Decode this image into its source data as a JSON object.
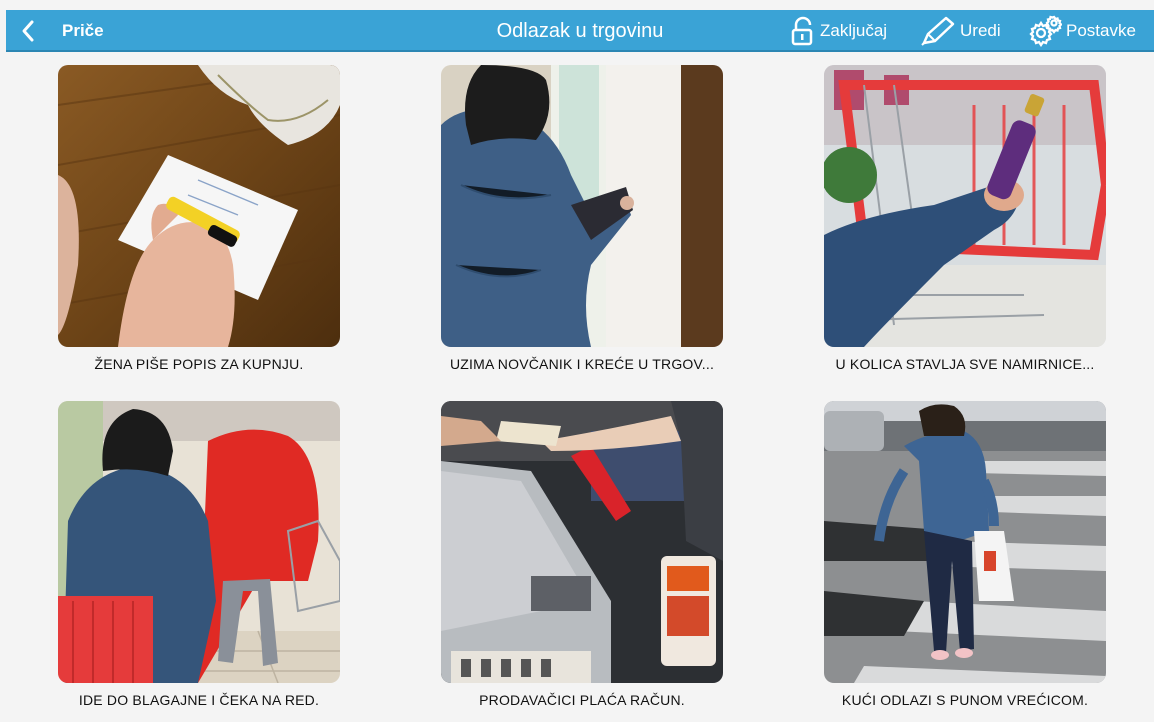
{
  "header": {
    "back_label": "Priče",
    "title": "Odlazak u trgovinu",
    "lock_label": "Zaključaj",
    "edit_label": "Uredi",
    "settings_label": "Postavke",
    "bg_color": "#3aa3d6"
  },
  "steps": [
    {
      "caption": "ŽENA PIŠE POPIS ZA KUPNJU."
    },
    {
      "caption": "UZIMA NOVČANIK I KREĆE U TRGOV..."
    },
    {
      "caption": "U KOLICA STAVLJA SVE NAMIRNICE..."
    },
    {
      "caption": "IDE DO BLAGAJNE I ČEKA NA RED."
    },
    {
      "caption": "PRODAVAČICI PLAĆA RAČUN."
    },
    {
      "caption": "KUĆI ODLAZI S PUNOM VREĆICOM."
    }
  ]
}
